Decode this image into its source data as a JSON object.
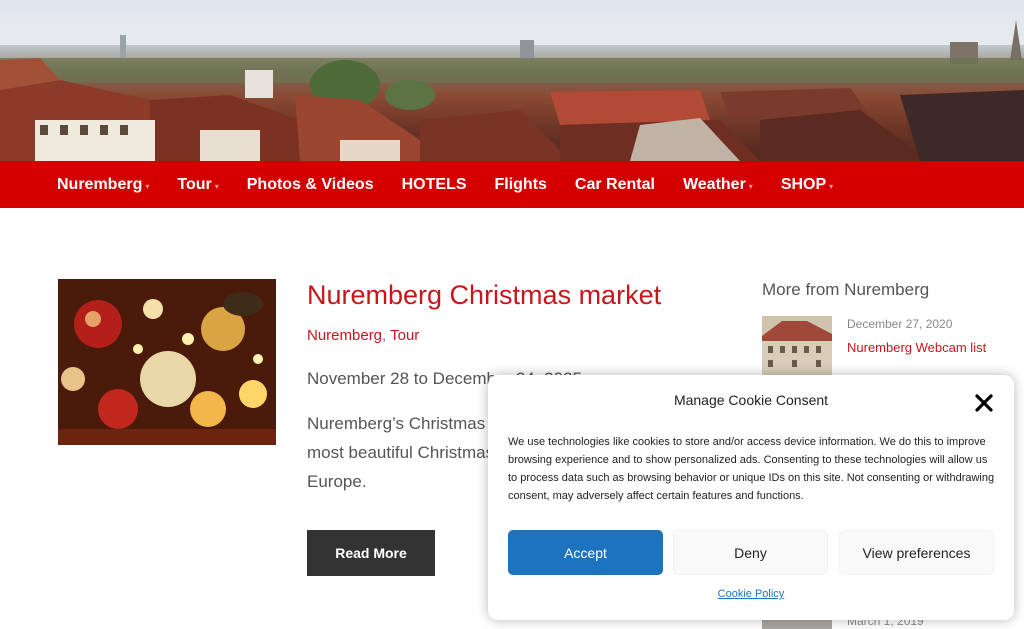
{
  "nav": {
    "items": [
      {
        "label": "Nuremberg",
        "has_submenu": true
      },
      {
        "label": "Tour",
        "has_submenu": true
      },
      {
        "label": "Photos & Videos",
        "has_submenu": false
      },
      {
        "label": "HOTELS",
        "has_submenu": false
      },
      {
        "label": "Flights",
        "has_submenu": false
      },
      {
        "label": "Car Rental",
        "has_submenu": false
      },
      {
        "label": "Weather",
        "has_submenu": true
      },
      {
        "label": "SHOP",
        "has_submenu": true
      }
    ],
    "background": "#d40000",
    "caret": "▾"
  },
  "post": {
    "title": "Nuremberg Christmas market",
    "categories": [
      "Nuremberg",
      "Tour"
    ],
    "category_separator": ",",
    "date_range": "November 28 to December 24, 2025",
    "excerpt": "Nuremberg’s Christmas market is one of the oldest and most beautiful Christmas markets in Germany and Europe.",
    "read_more": "Read More"
  },
  "sidebar": {
    "title": "More from Nuremberg",
    "items": [
      {
        "date": "December 27, 2020",
        "title": "Nuremberg Webcam list"
      },
      {
        "date": "March 1, 2019"
      }
    ]
  },
  "cookie": {
    "title": "Manage Cookie Consent",
    "text": "We use technologies like cookies to store and/or access device information. We do this to improve browsing experience and to show personalized ads. Consenting to these technologies will allow us to process data such as browsing behavior or unique IDs on this site. Not consenting or withdrawing consent, may adversely affect certain features and functions.",
    "accept": "Accept",
    "deny": "Deny",
    "preferences": "View preferences",
    "policy_link": "Cookie Policy",
    "accent": "#1e73be"
  },
  "colors": {
    "brand_red": "#d40000",
    "link_red": "#c8161d",
    "dark_button": "#333333"
  }
}
